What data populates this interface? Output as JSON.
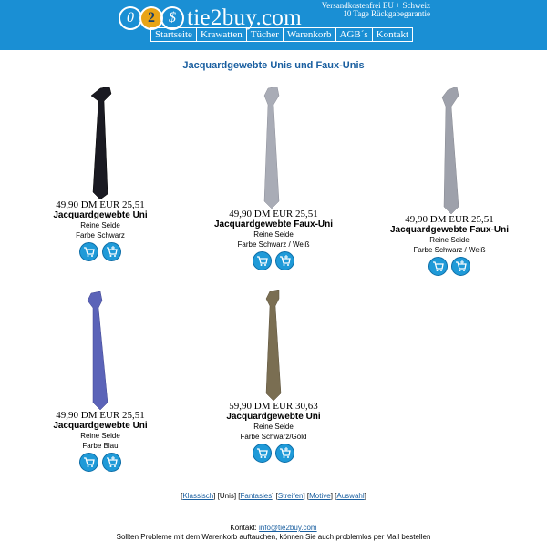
{
  "header": {
    "logo_chars": [
      "0",
      "2",
      "$"
    ],
    "logo_text": "tie2buy.com",
    "tagline_1": "Versandkostenfrei EU + Schweiz",
    "tagline_2": "10 Tage Rückgabegarantie",
    "nav": [
      "Startseite",
      "Krawatten",
      "Tücher",
      "Warenkorb",
      "AGB´s",
      "Kontakt"
    ]
  },
  "page": {
    "title": "Jacquardgewebte Unis und Faux-Unis"
  },
  "products": [
    {
      "price": "49,90 DM  EUR 25,51",
      "name": "Jacquardgewebte Uni",
      "material": "Reine Seide",
      "color": "Farbe Schwarz",
      "tie_color": "#1a1a22"
    },
    {
      "price": "49,90 DM  EUR 25,51",
      "name": "Jacquardgewebte Faux-Uni",
      "material": "Reine Seide",
      "color": "Farbe Schwarz / Weiß",
      "tie_color": "#a9acb6"
    },
    {
      "price": "49,90 DM  EUR 25,51",
      "name": "Jacquardgewebte Faux-Uni",
      "material": "Reine Seide",
      "color": "Farbe Schwarz / Weiß",
      "tie_color": "#9ea1ab"
    },
    {
      "price": "49,90 DM  EUR 25,51",
      "name": "Jacquardgewebte Uni",
      "material": "Reine Seide",
      "color": "Farbe Blau",
      "tie_color": "#5b63b8"
    },
    {
      "price": "59,90 DM  EUR 30,63",
      "name": "Jacquardgewebte Uni",
      "material": "Reine Seide",
      "color": "Farbe Schwarz/Gold",
      "tie_color": "#7a6e52"
    }
  ],
  "category_nav": {
    "items": [
      "Klassisch",
      "Unis",
      "Fantasies",
      "Streifen",
      "Motive",
      "Auswahl"
    ],
    "current": "Unis"
  },
  "footer": {
    "contact_label": "Kontakt:",
    "email": "info@tie2buy.com",
    "note": "Sollten Probleme mit dem Warenkorb auftauchen, können Sie auch problemlos per Mail bestellen"
  },
  "colors": {
    "header_bg": "#1a8fd4",
    "title_blue": "#1a5fa0",
    "icon_blue": "#1f9ad8"
  }
}
